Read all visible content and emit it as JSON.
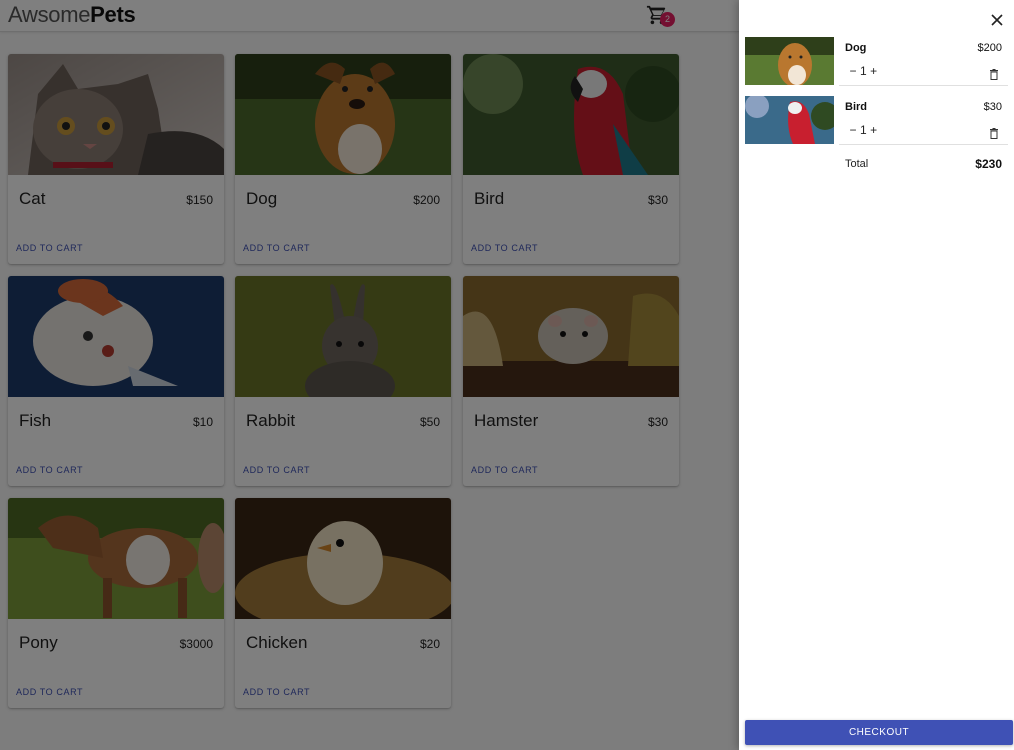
{
  "header": {
    "logo_light": "Awsome",
    "logo_bold": "Pets",
    "cart_count": "2",
    "cart_icon": "shopping-cart-icon"
  },
  "products": [
    {
      "name": "Cat",
      "price": "$150",
      "add_label": "ADD TO CART"
    },
    {
      "name": "Dog",
      "price": "$200",
      "add_label": "ADD TO CART"
    },
    {
      "name": "Bird",
      "price": "$30",
      "add_label": "ADD TO CART"
    },
    {
      "name": "Fish",
      "price": "$10",
      "add_label": "ADD TO CART"
    },
    {
      "name": "Rabbit",
      "price": "$50",
      "add_label": "ADD TO CART"
    },
    {
      "name": "Hamster",
      "price": "$30",
      "add_label": "ADD TO CART"
    },
    {
      "name": "Pony",
      "price": "$3000",
      "add_label": "ADD TO CART"
    },
    {
      "name": "Chicken",
      "price": "$20",
      "add_label": "ADD TO CART"
    }
  ],
  "cart": {
    "close_icon": "close-icon",
    "items": [
      {
        "name": "Dog",
        "price": "$200",
        "decrement": "−",
        "quantity": "1",
        "increment": "+",
        "delete_icon": "trash-icon"
      },
      {
        "name": "Bird",
        "price": "$30",
        "decrement": "−",
        "quantity": "1",
        "increment": "+",
        "delete_icon": "trash-icon"
      }
    ],
    "total_label": "Total",
    "total_value": "$230",
    "checkout_label": "CHECKOUT"
  },
  "colors": {
    "primary": "#3f51b5",
    "badge": "#e91e63",
    "overlay": "rgba(0,0,0,0.5)"
  }
}
